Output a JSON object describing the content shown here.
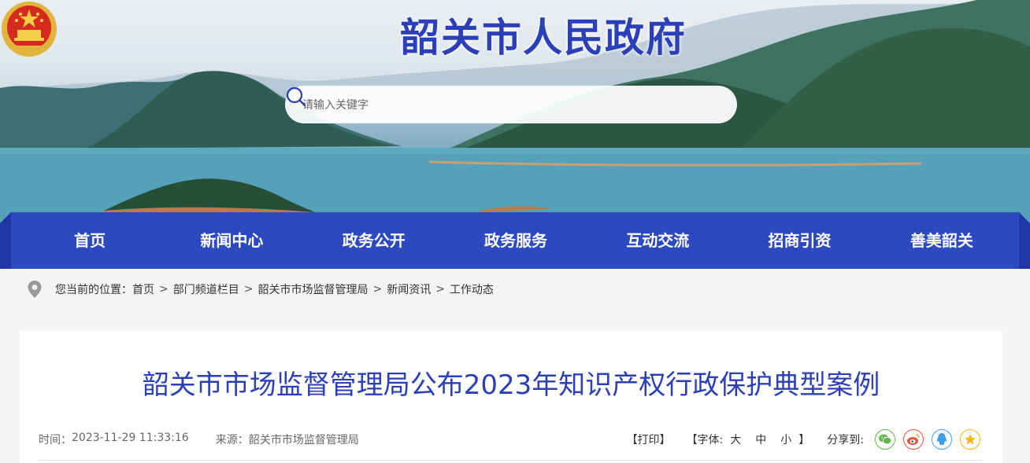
{
  "site": {
    "title": "韶关市人民政府"
  },
  "search": {
    "placeholder": "请输入关键字"
  },
  "nav": {
    "items": [
      "首页",
      "新闻中心",
      "政务公开",
      "政务服务",
      "互动交流",
      "招商引资",
      "善美韶关"
    ]
  },
  "breadcrumb": {
    "prefix": "您当前的位置：",
    "items": [
      "首页",
      "部门频道栏目",
      "韶关市市场监督管理局",
      "新闻资讯",
      "工作动态"
    ],
    "separator": ">"
  },
  "article": {
    "title": "韶关市市场监督管理局公布2023年知识产权行政保护典型案例",
    "time_label": "时间：",
    "time": "2023-11-29 11:33:16",
    "source_label": "来源：",
    "source": "韶关市市场监督管理局"
  },
  "tools": {
    "print": "【打印】",
    "font_open": "【字体:",
    "font_sizes": [
      "大",
      "中",
      "小"
    ],
    "font_close": "】",
    "share_label": "分享到:",
    "share_icons": [
      "wechat-icon",
      "weibo-icon",
      "qq-icon",
      "qzone-icon"
    ]
  },
  "colors": {
    "brand": "#2b3fb8",
    "nav": "#2c49c0",
    "wechat": "#5fb84b",
    "weibo": "#e1523d",
    "qq": "#3aa0e6",
    "qzone": "#f2b417"
  }
}
